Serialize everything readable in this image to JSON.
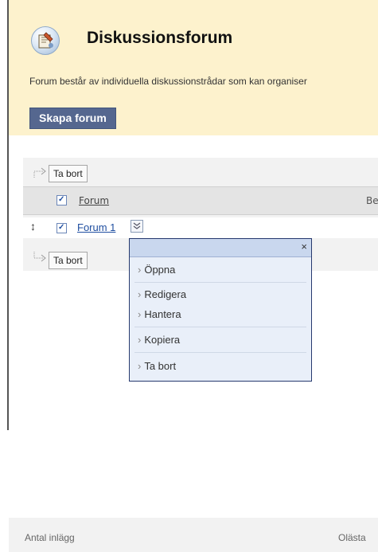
{
  "page": {
    "title": "Diskussionsforum",
    "description": "Forum består av individuella diskussionstrådar som kan organiser",
    "create_button": "Skapa forum"
  },
  "list": {
    "delete_button_top": "Ta bort",
    "delete_button_bottom": "Ta bort",
    "columns": {
      "forum": "Forum",
      "description": "Be"
    },
    "rows": [
      {
        "name": "Forum 1",
        "checked": true
      }
    ],
    "select_all_checked": true
  },
  "context_menu": {
    "close_label": "×",
    "items": [
      "Öppna",
      "Redigera",
      "Hantera",
      "Kopiera",
      "Ta bort"
    ]
  },
  "footer": {
    "left_label": "Antal inlägg",
    "right_label": "Olästa"
  },
  "colors": {
    "header_bg": "#fdf2cd",
    "button_bg": "#55678f",
    "link": "#1f4ea0",
    "menu_bg": "#e9eff9",
    "menu_border": "#26396e"
  },
  "icons": {
    "title": "discussion-forum-icon",
    "menu_trigger": "double-chevron-down-icon",
    "drag": "up-down-arrow-icon",
    "action_arrow": "bent-arrow-icon"
  }
}
